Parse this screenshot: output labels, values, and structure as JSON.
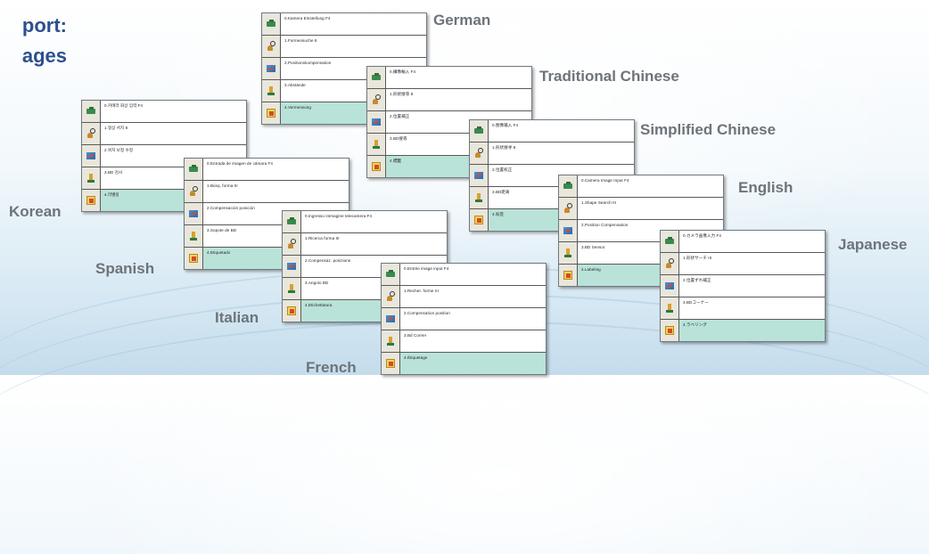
{
  "heading": {
    "line1": "port:",
    "line2": "ages"
  },
  "panels": [
    {
      "language": "German",
      "items": [
        "0.Kamera Einstellung F4",
        "1.Formensuche 8",
        "2.Positionskompensation",
        "3.Abstände",
        "4.Vermessung"
      ]
    },
    {
      "language": "Traditional Chinese",
      "items": [
        "0.攝像輸入 F4",
        "1.形狀搜尋 8",
        "2.位置補正",
        "3.BD搜尋",
        "4.標籤"
      ]
    },
    {
      "language": "Simplified Chinese",
      "items": [
        "0.图像输入 F4",
        "1.形状搜寻 8",
        "2.位置校正",
        "3.BD距离",
        "4.标签"
      ]
    },
    {
      "language": "Korean",
      "items": [
        "0.카메라 화상 입력 F4",
        "1.형상 서치 8",
        "2.위치 보정 수정",
        "3.BD 검사",
        "4.라벨링"
      ]
    },
    {
      "language": "English",
      "items": [
        "0.Camera Image Input F4",
        "1.Shape Search III",
        "2.Position Compensation",
        "3.BD Sensor",
        "4.Labeling"
      ]
    },
    {
      "language": "Spanish",
      "items": [
        "0.Entrada de imagen de cámara F4",
        "1.Búsq. forma III",
        "2.Compensación posición",
        "3.Sopote de BD",
        "4.Etiquetado"
      ]
    },
    {
      "language": "Japanese",
      "items": [
        "0.カメラ画像入力 F4",
        "1.形状サーチ III",
        "2.位置ずれ補正",
        "3.BDコーナー",
        "4.ラベリング"
      ]
    },
    {
      "language": "Italian",
      "items": [
        "0.Ingresso immagine telecamera F4",
        "1.Ricerca forma III",
        "2.Compensaz. posizione",
        "3.Angolo BD",
        "4.Etichettatura"
      ]
    },
    {
      "language": "French",
      "items": [
        "0.Entrée image input F4",
        "1.Recher. forme III",
        "2.Compensation position",
        "3.Bd Corner",
        "4.Étiquetage"
      ]
    }
  ]
}
